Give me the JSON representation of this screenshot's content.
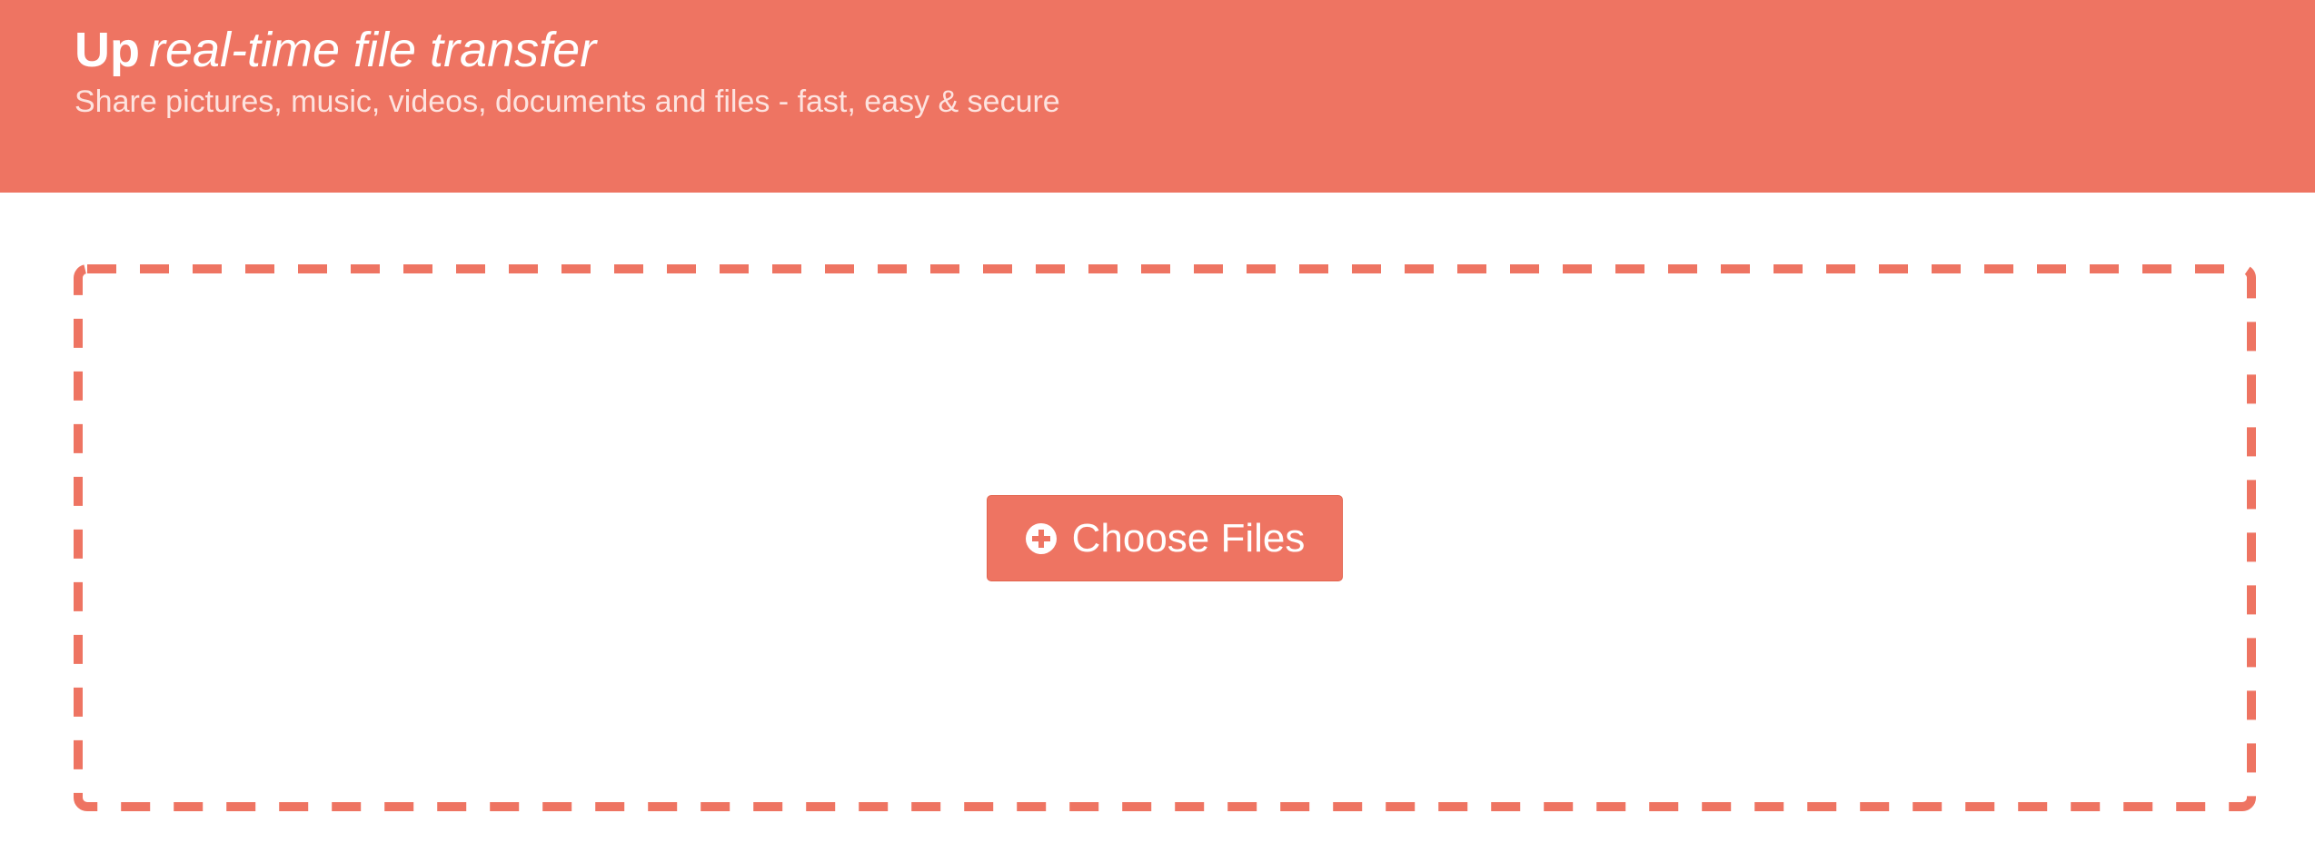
{
  "header": {
    "brand_name": "Up",
    "tagline": "real-time file transfer",
    "subtitle": "Share pictures, music, videos, documents and files - fast, easy & secure"
  },
  "dropzone": {
    "button_label": "Choose Files",
    "button_icon": "plus-circle-icon"
  },
  "colors": {
    "accent": "#ee7462",
    "header_text": "#ffffff",
    "subtitle_text": "#fde3df",
    "background": "#ffffff"
  }
}
